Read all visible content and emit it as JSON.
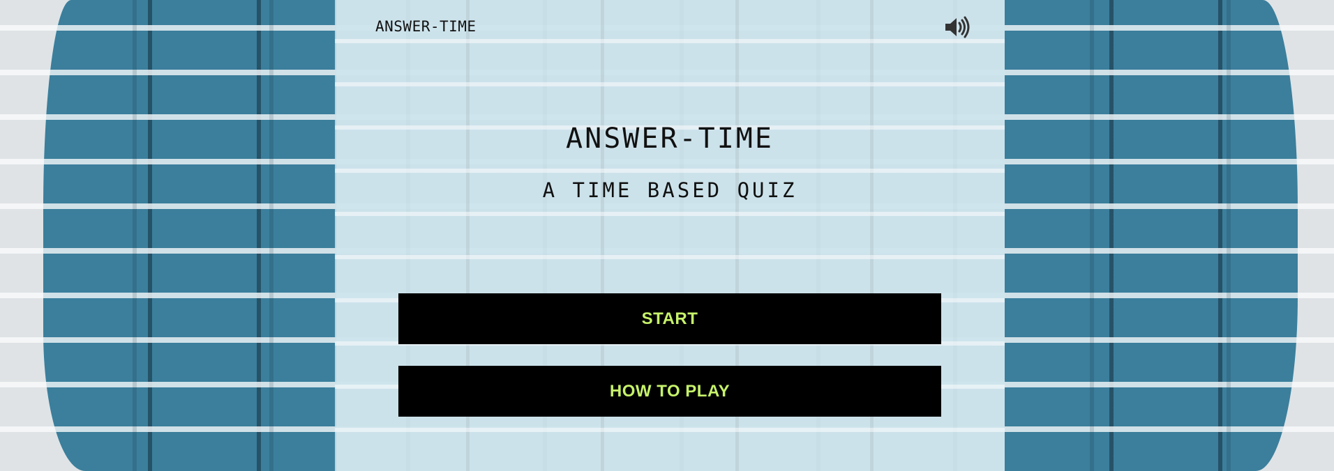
{
  "header": {
    "brand": "ANSWER-TIME",
    "sound_icon": "speaker-volume-icon"
  },
  "main": {
    "title": "ANSWER-TIME",
    "subtitle": "A TIME BASED QUIZ"
  },
  "menu": {
    "start_label": "START",
    "how_to_play_label": "HOW TO PLAY"
  },
  "colors": {
    "button_bg": "#000000",
    "button_text": "#c6f26a",
    "panel_bg": "#c8e2eb",
    "wall_paint": "#3b7f9c"
  }
}
